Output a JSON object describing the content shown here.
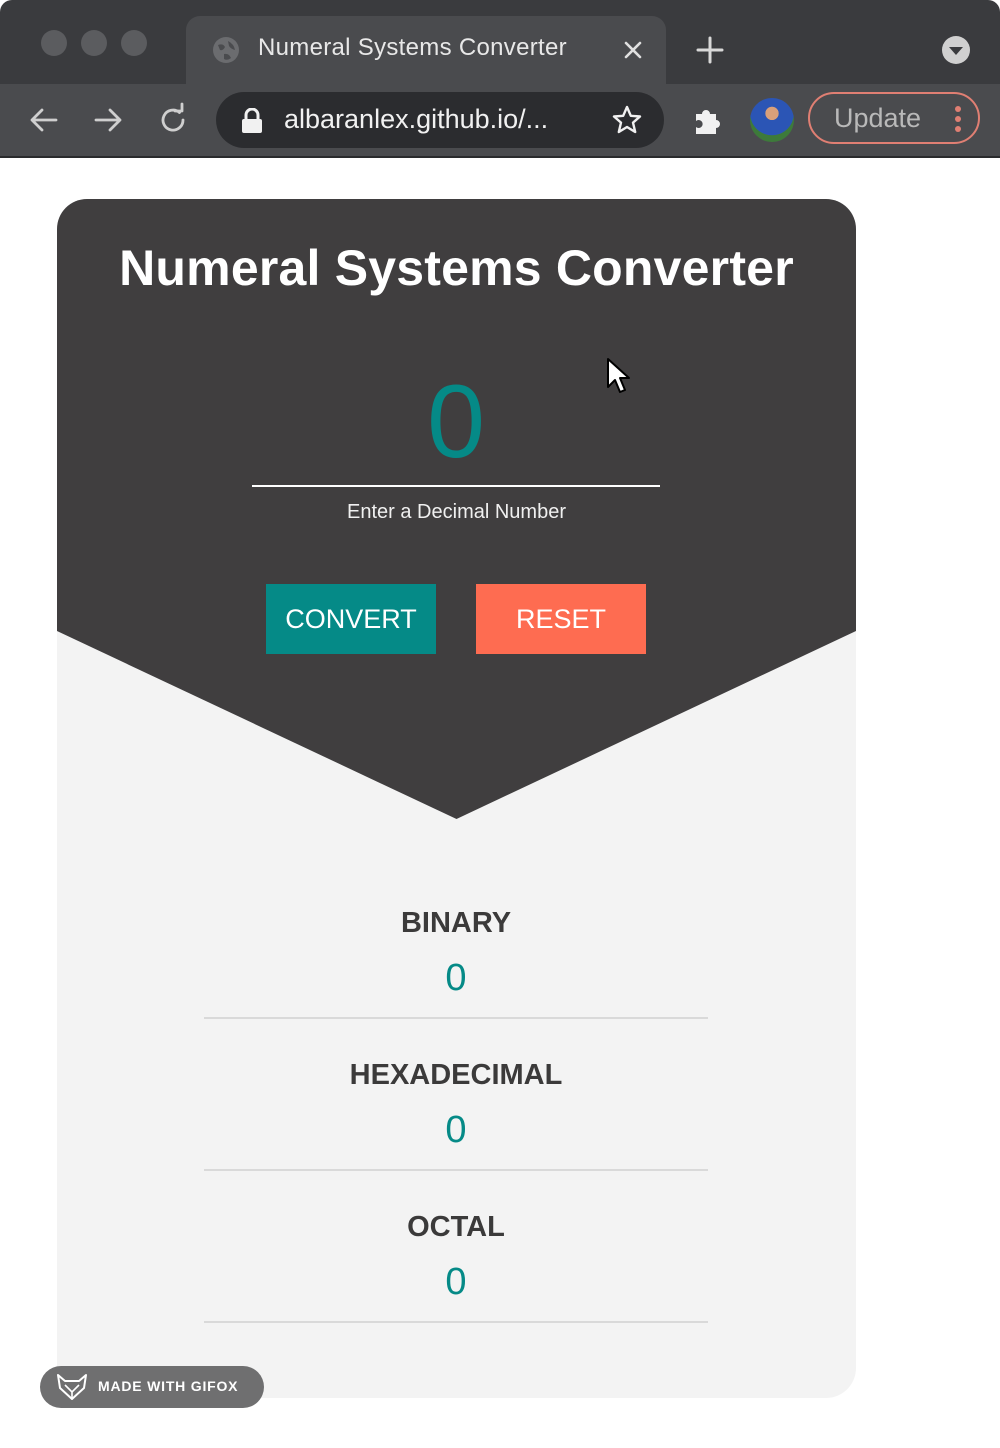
{
  "browser": {
    "tab_title": "Numeral Systems Converter",
    "url": "albaranlex.github.io/...",
    "update_label": "Update",
    "icons": [
      "globe-icon",
      "close-icon",
      "plus-icon",
      "chevron-down-icon",
      "back-arrow-icon",
      "forward-arrow-icon",
      "reload-icon",
      "lock-icon",
      "star-icon",
      "extensions-puzzle-icon",
      "kebab-menu-icon"
    ]
  },
  "app": {
    "title": "Numeral Systems Converter",
    "decimal_input": {
      "value": "",
      "placeholder": "0",
      "label": "Enter a Decimal Number"
    },
    "buttons": {
      "convert": "CONVERT",
      "reset": "RESET"
    },
    "results": [
      {
        "label": "BINARY",
        "value": "0"
      },
      {
        "label": "HEXADECIMAL",
        "value": "0"
      },
      {
        "label": "OCTAL",
        "value": "0"
      }
    ]
  },
  "watermark": {
    "text": "MADE WITH GIFOX"
  },
  "colors": {
    "teal": "#058a87",
    "coral": "#fe6c51",
    "card_dark": "#403e3f",
    "card_light": "#f3f3f3",
    "chrome_dark": "#3a3b3e",
    "update_border": "#e07f73"
  }
}
